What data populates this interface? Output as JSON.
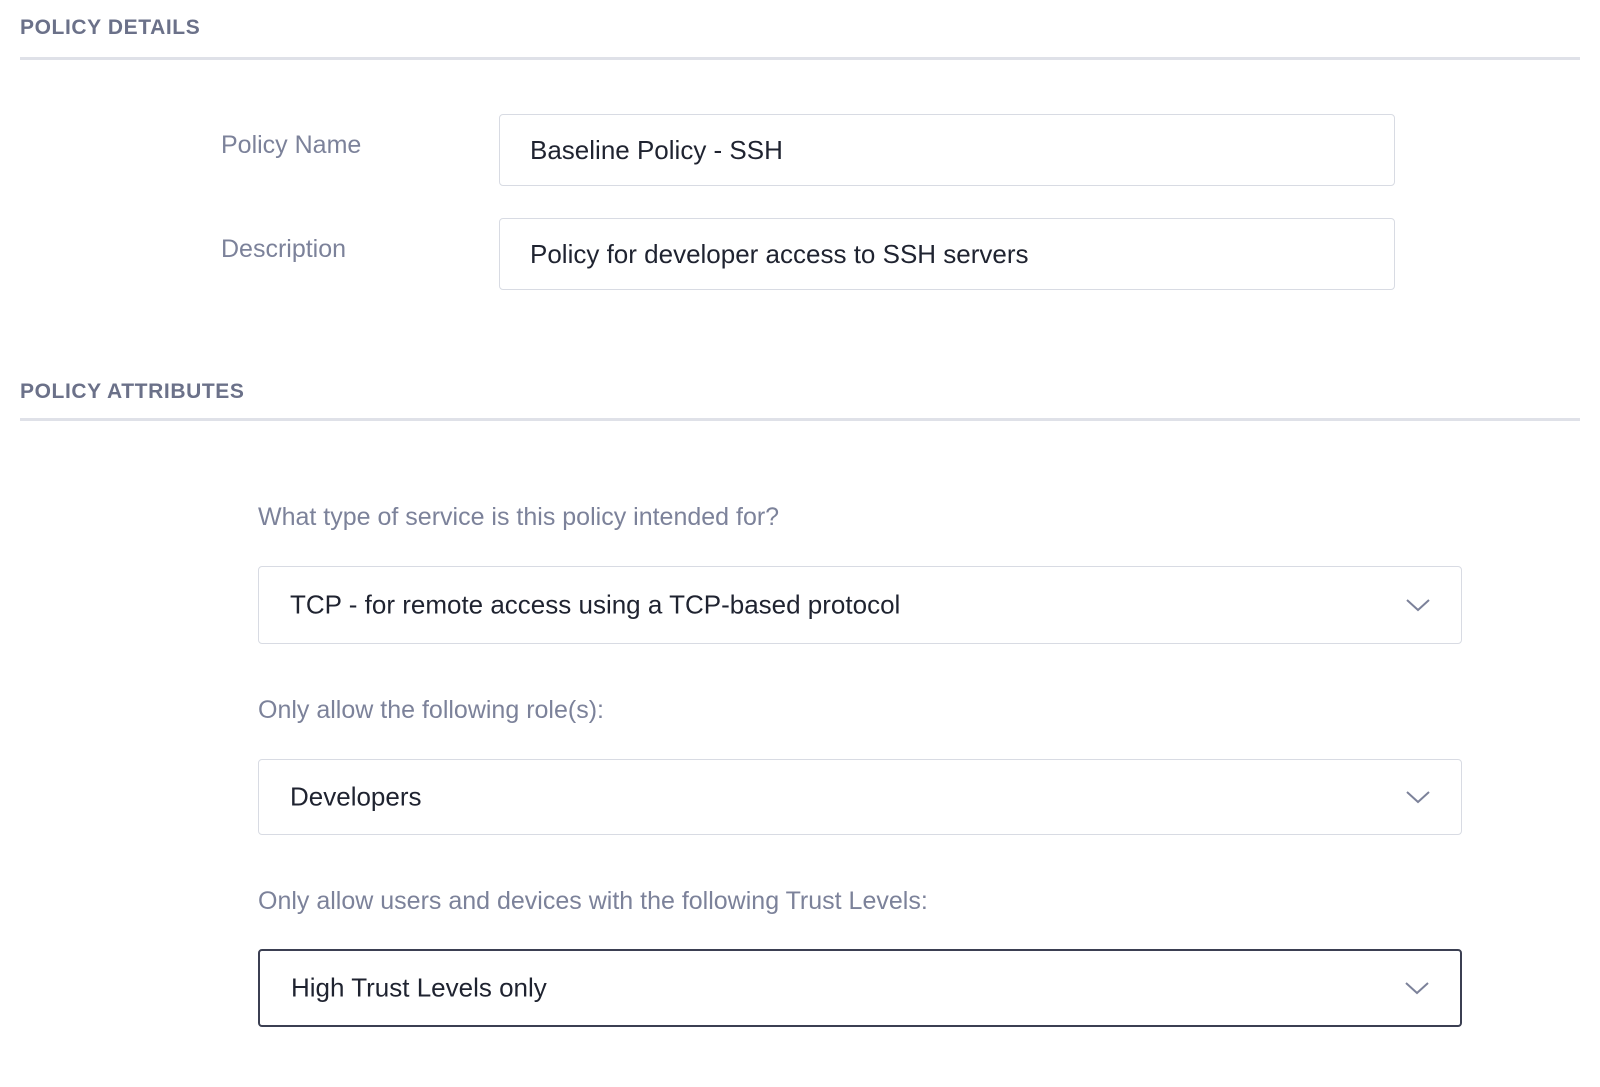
{
  "policy_details": {
    "section_title": "POLICY DETAILS",
    "name_label": "Policy Name",
    "name_value": "Baseline Policy - SSH",
    "description_label": "Description",
    "description_value": "Policy for developer access to SSH servers"
  },
  "policy_attributes": {
    "section_title": "POLICY ATTRIBUTES",
    "service_question": "What type of service is this policy intended for?",
    "service_value": "TCP - for remote access using a TCP-based protocol",
    "roles_question": "Only allow the following role(s):",
    "roles_value": "Developers",
    "trust_question": "Only allow users and devices with the following Trust Levels:",
    "trust_value": "High Trust Levels only"
  },
  "icons": {
    "dropdown": "chevron-down-icon"
  },
  "colors": {
    "section_header": "#6b7189",
    "label": "#7c829a",
    "text": "#1f2330",
    "border": "#d8dbe3",
    "focused_border": "#3b3f52"
  }
}
